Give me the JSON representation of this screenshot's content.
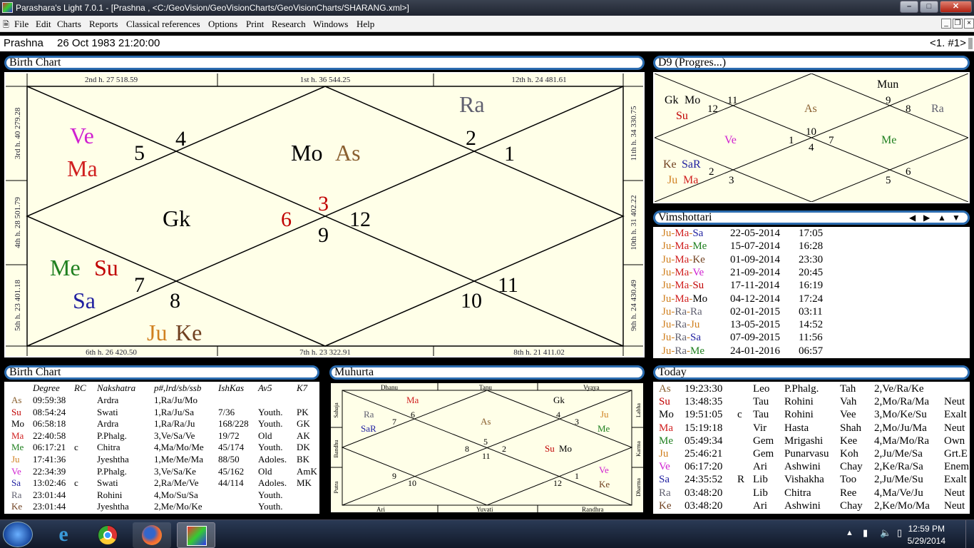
{
  "window": {
    "title": "Parashara's Light 7.0.1 - [Prashna ,  <C:/GeoVision/GeoVisionCharts/GeoVisionCharts/SHARANG.xml>]"
  },
  "menu": [
    "File",
    "Edit",
    "Charts",
    "Reports",
    "Classical references",
    "Options",
    "Print",
    "Research",
    "Windows",
    "Help"
  ],
  "info": {
    "label": "Prashna",
    "datetime": "26 Oct 1983 21:20:00",
    "index": "<1. #1>"
  },
  "panels": {
    "birth_chart": "Birth Chart",
    "d9": "D9 (Progres...)",
    "vimshottari": "Vimshottari",
    "birth_table": "Birth Chart",
    "muhurta": "Muhurta",
    "today": "Today"
  },
  "colors": {
    "panel_border": "#2b6cb0",
    "chart_bg": "#ffffe8",
    "Su": "#c00000",
    "Mo": "#000000",
    "Ma": "#d02020",
    "Me": "#208020",
    "Ju": "#d08020",
    "Ve": "#d020d0",
    "Sa": "#2020a0",
    "Ra": "#606070",
    "Ke": "#704020",
    "As": "#8a6030",
    "Gk": "#000000"
  },
  "main_chart": {
    "top_labels": [
      "2nd h.  27  518.59",
      "1st h.  36  544.25",
      "12th h.  24  481.61"
    ],
    "bottom_labels": [
      "6th h.  26  420.50",
      "7th h.  23  322.91",
      "8th h.  21  411.02"
    ],
    "left_labels": [
      "3rd h.  40  279.28",
      "4th h.  28  501.79",
      "5th h.  23  401.18"
    ],
    "right_labels": [
      "11th h.  34  330.75",
      "10th h.  31  402.22",
      "9th h.  24  430.49"
    ],
    "house_numbers": [
      "4",
      "5",
      "2",
      "1",
      "3",
      "6",
      "9",
      "12",
      "7",
      "8",
      "10",
      "11"
    ],
    "planets": {
      "ve": "Ve",
      "ma": "Ma",
      "mo": "Mo",
      "as": "As",
      "ra": "Ra",
      "gk": "Gk",
      "me": "Me",
      "su": "Su",
      "sa": "Sa",
      "ju": "Ju",
      "ke": "Ke"
    }
  },
  "d9_chart": {
    "planets": {
      "mun": "Mun",
      "gk": "Gk",
      "mo": "Mo",
      "su": "Su",
      "as": "As",
      "ra": "Ra",
      "ve": "Ve",
      "me": "Me",
      "ke": "Ke",
      "sar": "SaR",
      "ju": "Ju",
      "ma": "Ma"
    },
    "house_numbers": [
      "11",
      "12",
      "9",
      "8",
      "10",
      "1",
      "7",
      "4",
      "2",
      "3",
      "5",
      "6"
    ]
  },
  "vimshottari": [
    {
      "lords": [
        "Ju",
        "Ma",
        "Sa"
      ],
      "date": "22-05-2014",
      "time": "17:05"
    },
    {
      "lords": [
        "Ju",
        "Ma",
        "Me"
      ],
      "date": "15-07-2014",
      "time": "16:28"
    },
    {
      "lords": [
        "Ju",
        "Ma",
        "Ke"
      ],
      "date": "01-09-2014",
      "time": "23:30"
    },
    {
      "lords": [
        "Ju",
        "Ma",
        "Ve"
      ],
      "date": "21-09-2014",
      "time": "20:45"
    },
    {
      "lords": [
        "Ju",
        "Ma",
        "Su"
      ],
      "date": "17-11-2014",
      "time": "16:19"
    },
    {
      "lords": [
        "Ju",
        "Ma",
        "Mo"
      ],
      "date": "04-12-2014",
      "time": "17:24"
    },
    {
      "lords": [
        "Ju",
        "Ra",
        "Ra"
      ],
      "date": "02-01-2015",
      "time": "03:11"
    },
    {
      "lords": [
        "Ju",
        "Ra",
        "Ju"
      ],
      "date": "13-05-2015",
      "time": "14:52"
    },
    {
      "lords": [
        "Ju",
        "Ra",
        "Sa"
      ],
      "date": "07-09-2015",
      "time": "11:56"
    },
    {
      "lords": [
        "Ju",
        "Ra",
        "Me"
      ],
      "date": "24-01-2016",
      "time": "06:57"
    }
  ],
  "birth_table": {
    "headers": [
      "Degree",
      "RC",
      "Nakshatra",
      "p#,lrd/sb/ssb",
      "IshKas",
      "Av5",
      "K7"
    ],
    "rows": [
      [
        "As",
        "09:59:38",
        "",
        "Ardra",
        "1,Ra/Ju/Mo",
        "",
        "",
        ""
      ],
      [
        "Su",
        "08:54:24",
        "",
        "Swati",
        "1,Ra/Ju/Sa",
        "7/36",
        "Youth.",
        "PK"
      ],
      [
        "Mo",
        "06:58:18",
        "",
        "Ardra",
        "1,Ra/Ra/Ju",
        "168/228",
        "Youth.",
        "GK"
      ],
      [
        "Ma",
        "22:40:58",
        "",
        "P.Phalg.",
        "3,Ve/Sa/Ve",
        "19/72",
        "Old",
        "AK"
      ],
      [
        "Me",
        "06:17:21",
        "c",
        "Chitra",
        "4,Ma/Mo/Me",
        "45/174",
        "Youth.",
        "DK"
      ],
      [
        "Ju",
        "17:41:36",
        "",
        "Jyeshtha",
        "1,Me/Me/Ma",
        "88/50",
        "Adoles.",
        "BK"
      ],
      [
        "Ve",
        "22:34:39",
        "",
        "P.Phalg.",
        "3,Ve/Sa/Ke",
        "45/162",
        "Old",
        "AmK"
      ],
      [
        "Sa",
        "13:02:46",
        "c",
        "Swati",
        "2,Ra/Me/Ve",
        "44/114",
        "Adoles.",
        "MK"
      ],
      [
        "Ra",
        "23:01:44",
        "",
        "Rohini",
        "4,Mo/Su/Sa",
        "",
        "Youth.",
        ""
      ],
      [
        "Ke",
        "23:01:44",
        "",
        "Jyeshtha",
        "2,Me/Mo/Ke",
        "",
        "Youth.",
        ""
      ]
    ]
  },
  "muhurta": {
    "top_labels": [
      "Dhanu",
      "Tanu",
      "Vyaya"
    ],
    "bottom_labels": [
      "Ari",
      "Yuvati",
      "Randhra"
    ],
    "left_labels": [
      "Sahaja",
      "Bandhu",
      "Putra"
    ],
    "right_labels": [
      "Labha",
      "Karma",
      "Dharma"
    ],
    "planets": {
      "ma": "Ma",
      "gk": "Gk",
      "ra": "Ra",
      "sar": "SaR",
      "as": "As",
      "ju": "Ju",
      "me": "Me",
      "su": "Su",
      "mo": "Mo",
      "ve": "Ve",
      "ke": "Ke"
    },
    "house_numbers": [
      "6",
      "4",
      "7",
      "3",
      "5",
      "8",
      "11",
      "2",
      "9",
      "10",
      "12",
      "1"
    ]
  },
  "today": [
    [
      "As",
      "19:23:30",
      "",
      "Leo",
      "P.Phalg.",
      "Tah",
      "2,Ve/Ra/Ke",
      ""
    ],
    [
      "Su",
      "13:48:35",
      "",
      "Tau",
      "Rohini",
      "Vah",
      "2,Mo/Ra/Ma",
      "Neut"
    ],
    [
      "Mo",
      "19:51:05",
      "c",
      "Tau",
      "Rohini",
      "Vee",
      "3,Mo/Ke/Su",
      "Exalt"
    ],
    [
      "Ma",
      "15:19:18",
      "",
      "Vir",
      "Hasta",
      "Shah",
      "2,Mo/Ju/Ma",
      "Neut"
    ],
    [
      "Me",
      "05:49:34",
      "",
      "Gem",
      "Mrigashi",
      "Kee",
      "4,Ma/Mo/Ra",
      "Own"
    ],
    [
      "Ju",
      "25:46:21",
      "",
      "Gem",
      "Punarvasu",
      "Koh",
      "2,Ju/Me/Sa",
      "Grt.E"
    ],
    [
      "Ve",
      "06:17:20",
      "",
      "Ari",
      "Ashwini",
      "Chay",
      "2,Ke/Ra/Sa",
      "Enem"
    ],
    [
      "Sa",
      "24:35:52",
      "R",
      "Lib",
      "Vishakha",
      "Too",
      "2,Ju/Me/Su",
      "Exalt"
    ],
    [
      "Ra",
      "03:48:20",
      "",
      "Lib",
      "Chitra",
      "Ree",
      "4,Ma/Ve/Ju",
      "Neut"
    ],
    [
      "Ke",
      "03:48:20",
      "",
      "Ari",
      "Ashwini",
      "Chay",
      "2,Ke/Mo/Ma",
      "Neut"
    ]
  ],
  "taskbar": {
    "time": "12:59 PM",
    "date": "5/29/2014"
  }
}
